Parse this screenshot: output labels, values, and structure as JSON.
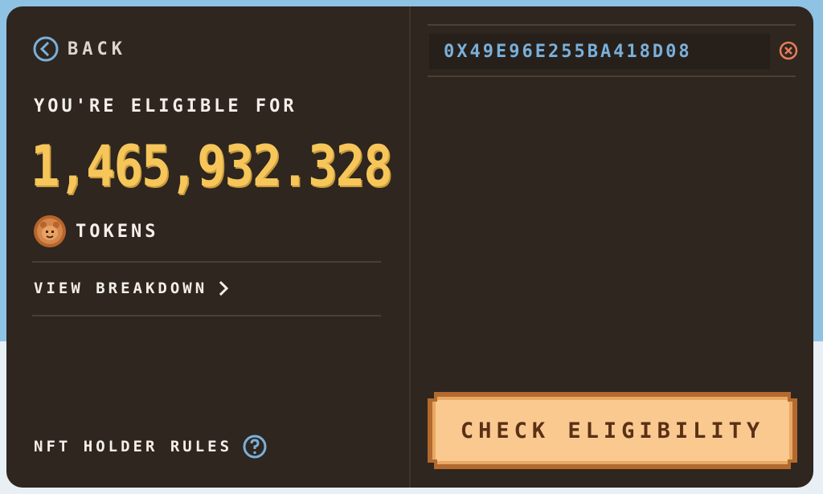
{
  "left_panel": {
    "back_label": "BACK",
    "eligible_title": "YOU'RE ELIGIBLE FOR",
    "amount": "1,465,932.328",
    "tokens_label": "TOKENS",
    "breakdown_label": "VIEW BREAKDOWN",
    "rules_label": "NFT HOLDER RULES"
  },
  "right_panel": {
    "address_value": "0X49E96E255BA418D08",
    "check_button_label": "CHECK ELIGIBILITY"
  },
  "colors": {
    "card_bg": "#2e261f",
    "amount": "#f6c65a",
    "accent_blue": "#7ab0db",
    "clear_icon": "#e97c5c",
    "button_fill": "#f9c98f",
    "button_text": "#5a3016"
  },
  "icons": {
    "back": "circle-chevron-left-icon",
    "token": "bear-coin-icon",
    "breakdown": "chevron-right-icon",
    "rules": "question-circle-icon",
    "clear": "close-circle-icon"
  }
}
